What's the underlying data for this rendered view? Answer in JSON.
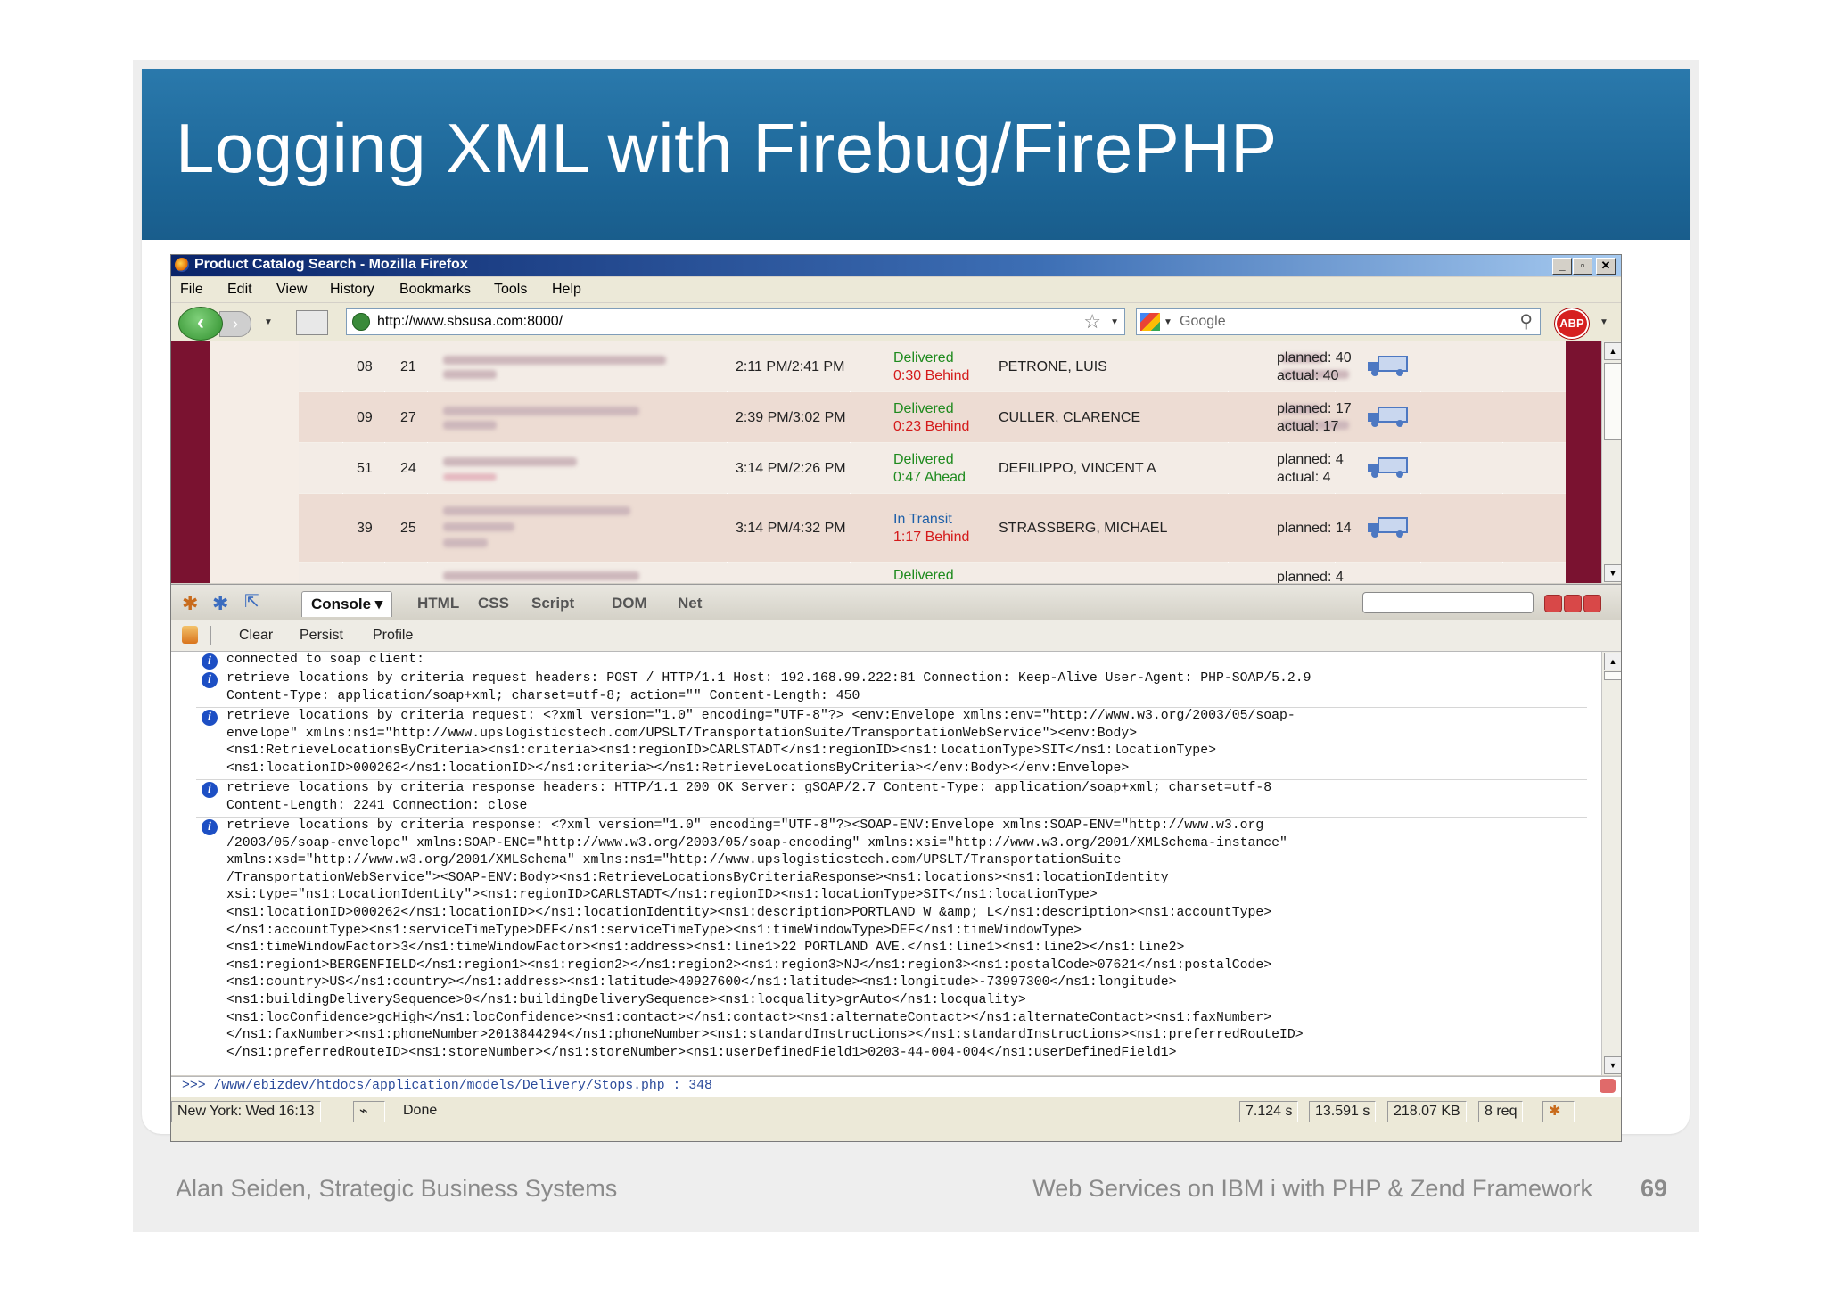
{
  "slide": {
    "title": "Logging XML with Firebug/FirePHP",
    "footer_left": "Alan Seiden, Strategic Business Systems",
    "footer_right": "Web Services on IBM i with PHP & Zend Framework",
    "page_number": "69"
  },
  "window": {
    "title": "Product Catalog Search - Mozilla Firefox",
    "menu": [
      "File",
      "Edit",
      "View",
      "History",
      "Bookmarks",
      "Tools",
      "Help"
    ],
    "url": "http://www.sbsusa.com:8000/",
    "search_placeholder": "Google",
    "abp_label": "ABP"
  },
  "rows": [
    {
      "a": "08",
      "b": "21",
      "time": "2:11 PM/2:41 PM",
      "status1": "Delivered",
      "status2": "0:30 Behind",
      "status2_color": "red",
      "driver": "PETRONE, LUIS",
      "plan1": "planned: 40",
      "plan2": "actual: 40"
    },
    {
      "a": "09",
      "b": "27",
      "time": "2:39 PM/3:02 PM",
      "status1": "Delivered",
      "status2": "0:23 Behind",
      "status2_color": "red",
      "driver": "CULLER, CLARENCE",
      "plan1": "planned: 17",
      "plan2": "actual: 17"
    },
    {
      "a": "51",
      "b": "24",
      "time": "3:14 PM/2:26 PM",
      "status1": "Delivered",
      "status2": "0:47 Ahead",
      "status2_color": "green",
      "driver": "DEFILIPPO, VINCENT A",
      "plan1": "planned: 4",
      "plan2": "actual: 4"
    },
    {
      "a": "39",
      "b": "25",
      "time": "3:14 PM/4:32 PM",
      "status1": "In Transit",
      "status2": "1:17 Behind",
      "status2_color": "red",
      "driver": "STRASSBERG, MICHAEL",
      "plan1": "planned: 14",
      "plan2": ""
    },
    {
      "a": "",
      "b": "",
      "time": "",
      "status1": "Delivered",
      "status2": "",
      "status2_color": "red",
      "driver": "",
      "plan1": "planned: 4",
      "plan2": ""
    }
  ],
  "firebug": {
    "tabs": [
      "Console",
      "HTML",
      "CSS",
      "Script",
      "DOM",
      "Net"
    ],
    "sub": [
      "Clear",
      "Persist",
      "Profile"
    ],
    "entries": [
      "connected to soap client:",
      "retrieve locations by criteria request headers: POST / HTTP/1.1 Host: 192.168.99.222:81 Connection: Keep-Alive User-Agent: PHP-SOAP/5.2.9\nContent-Type: application/soap+xml; charset=utf-8; action=\"\" Content-Length: 450",
      "retrieve locations by criteria request: <?xml version=\"1.0\" encoding=\"UTF-8\"?> <env:Envelope xmlns:env=\"http://www.w3.org/2003/05/soap-\nenvelope\" xmlns:ns1=\"http://www.upslogisticstech.com/UPSLT/TransportationSuite/TransportationWebService\"><env:Body>\n<ns1:RetrieveLocationsByCriteria><ns1:criteria><ns1:regionID>CARLSTADT</ns1:regionID><ns1:locationType>SIT</ns1:locationType>\n<ns1:locationID>000262</ns1:locationID></ns1:criteria></ns1:RetrieveLocationsByCriteria></env:Body></env:Envelope>",
      "retrieve locations by criteria response headers: HTTP/1.1 200 OK Server: gSOAP/2.7 Content-Type: application/soap+xml; charset=utf-8\nContent-Length: 2241 Connection: close",
      "retrieve locations by criteria response: <?xml version=\"1.0\" encoding=\"UTF-8\"?><SOAP-ENV:Envelope xmlns:SOAP-ENV=\"http://www.w3.org\n/2003/05/soap-envelope\" xmlns:SOAP-ENC=\"http://www.w3.org/2003/05/soap-encoding\" xmlns:xsi=\"http://www.w3.org/2001/XMLSchema-instance\"\nxmlns:xsd=\"http://www.w3.org/2001/XMLSchema\" xmlns:ns1=\"http://www.upslogisticstech.com/UPSLT/TransportationSuite\n/TransportationWebService\"><SOAP-ENV:Body><ns1:RetrieveLocationsByCriteriaResponse><ns1:locations><ns1:locationIdentity\nxsi:type=\"ns1:LocationIdentity\"><ns1:regionID>CARLSTADT</ns1:regionID><ns1:locationType>SIT</ns1:locationType>\n<ns1:locationID>000262</ns1:locationID></ns1:locationIdentity><ns1:description>PORTLAND W &amp; L</ns1:description><ns1:accountType>\n</ns1:accountType><ns1:serviceTimeType>DEF</ns1:serviceTimeType><ns1:timeWindowType>DEF</ns1:timeWindowType>\n<ns1:timeWindowFactor>3</ns1:timeWindowFactor><ns1:address><ns1:line1>22 PORTLAND AVE.</ns1:line1><ns1:line2></ns1:line2>\n<ns1:region1>BERGENFIELD</ns1:region1><ns1:region2></ns1:region2><ns1:region3>NJ</ns1:region3><ns1:postalCode>07621</ns1:postalCode>\n<ns1:country>US</ns1:country></ns1:address><ns1:latitude>40927600</ns1:latitude><ns1:longitude>-73997300</ns1:longitude>\n<ns1:buildingDeliverySequence>0</ns1:buildingDeliverySequence><ns1:locquality>grAuto</ns1:locquality>\n<ns1:locConfidence>gcHigh</ns1:locConfidence><ns1:contact></ns1:contact><ns1:alternateContact></ns1:alternateContact><ns1:faxNumber>\n</ns1:faxNumber><ns1:phoneNumber>2013844294</ns1:phoneNumber><ns1:standardInstructions></ns1:standardInstructions><ns1:preferredRouteID>\n</ns1:preferredRouteID><ns1:storeNumber></ns1:storeNumber><ns1:userDefinedField1>0203-44-004-004</ns1:userDefinedField1>"
    ],
    "command_line": ">>> /www/ebizdev/htdocs/application/models/Delivery/Stops.php : 348"
  },
  "statusbar": {
    "clock": "New York: Wed 16:13",
    "status": "Done",
    "t1": "7.124 s",
    "t2": "13.591 s",
    "size": "218.07 KB",
    "req": "8 req"
  },
  "colors": {
    "header_blue": "#1c6596",
    "page_maroon": "#7a1230",
    "delivered_green": "#1d8a1d",
    "behind_red": "#d41a1a"
  }
}
